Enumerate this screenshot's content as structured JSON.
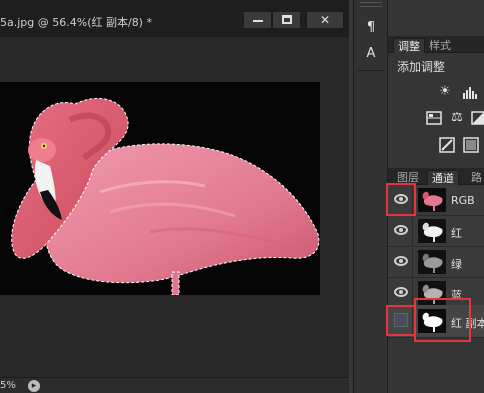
{
  "document": {
    "title": "5a.jpg @ 56.4%(红 副本/8) *",
    "zoom_status": "5%"
  },
  "tool_strip": {
    "paragraph_icon": "¶",
    "character_icon": "A"
  },
  "adjustments_panel": {
    "tabs": [
      {
        "label": "调整",
        "active": true
      },
      {
        "label": "样式",
        "active": false
      }
    ],
    "add_label": "添加调整"
  },
  "layers_panel": {
    "tabs": [
      {
        "label": "图层",
        "active": false
      },
      {
        "label": "通道",
        "active": true
      },
      {
        "label": "路",
        "active": false
      }
    ],
    "channels": [
      {
        "name": "RGB",
        "visible": true,
        "thumbnail": "color"
      },
      {
        "name": "红",
        "visible": true,
        "thumbnail": "gray-light"
      },
      {
        "name": "绿",
        "visible": true,
        "thumbnail": "gray"
      },
      {
        "name": "蓝",
        "visible": true,
        "thumbnail": "gray-dark"
      },
      {
        "name": "红 副本",
        "visible": false,
        "thumbnail": "mask",
        "selected": true
      }
    ]
  },
  "colors": {
    "flamingo": "#e27a8f",
    "highlight": "#e3363a"
  }
}
